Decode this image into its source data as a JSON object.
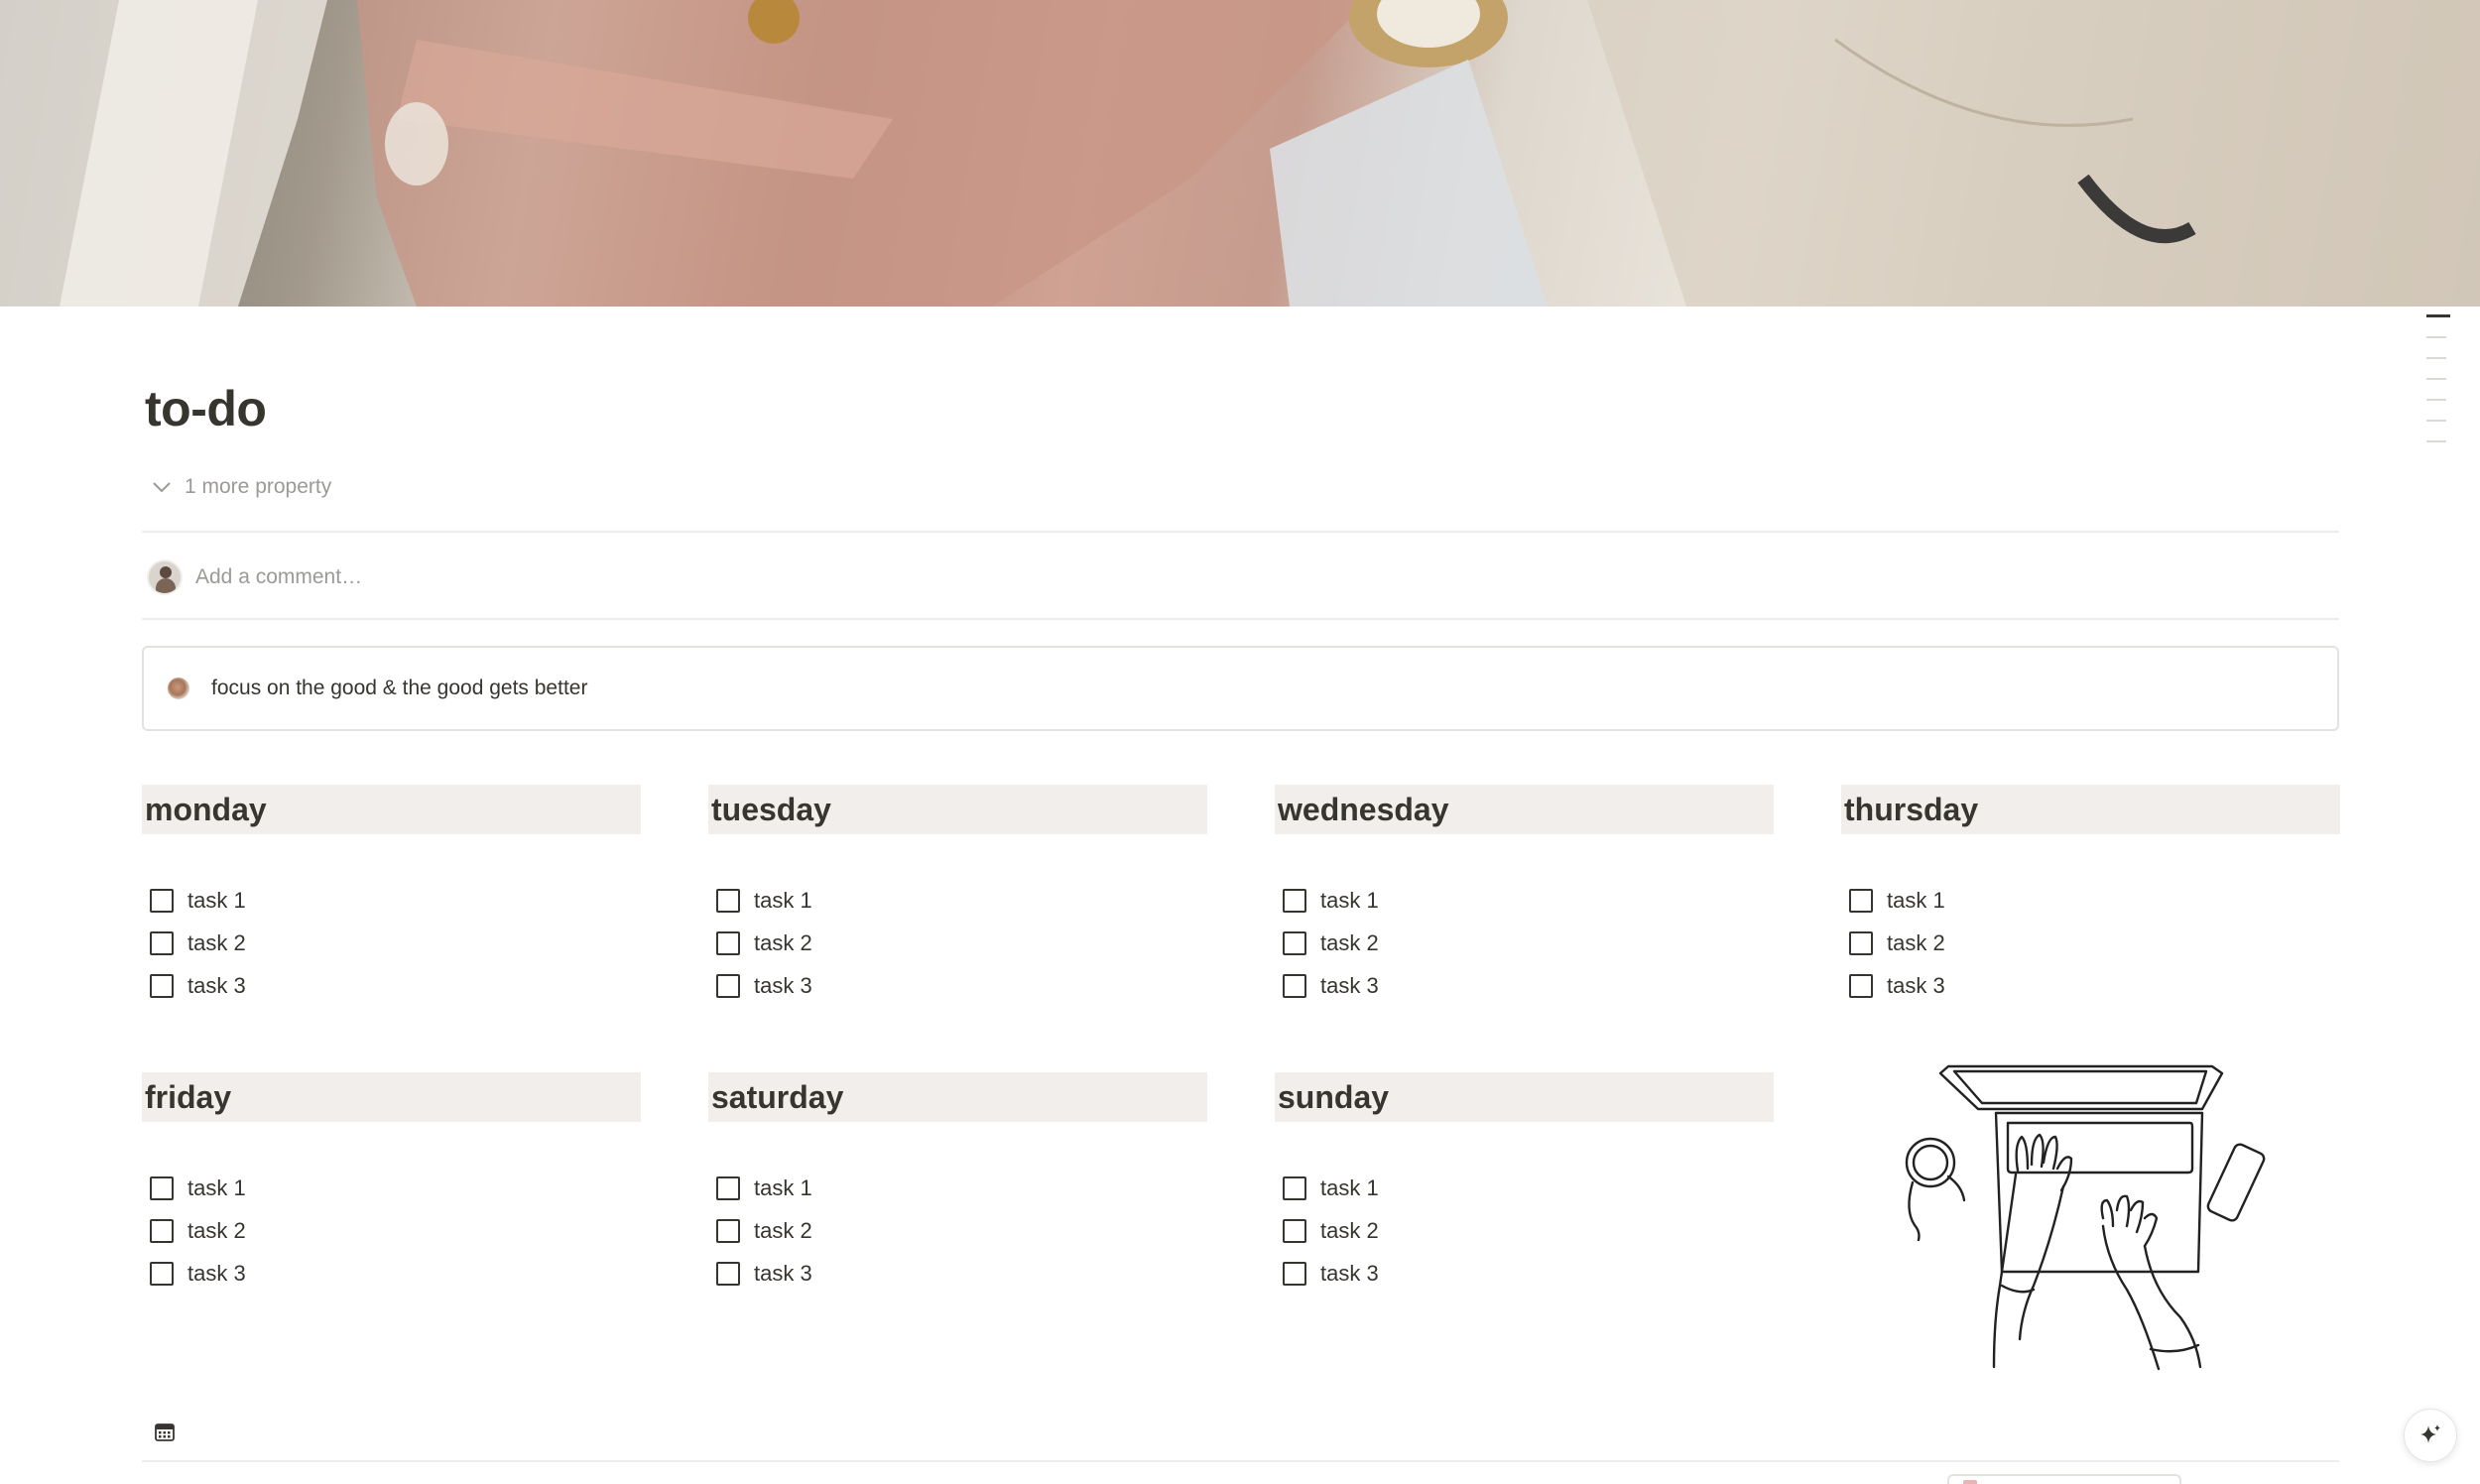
{
  "page": {
    "title": "to-do",
    "more_property": "1 more property",
    "comment_placeholder": "Add a comment…"
  },
  "callout": {
    "text": "focus on the good & the good gets better"
  },
  "days": [
    {
      "name": "monday",
      "tasks": [
        "task 1",
        "task 2",
        "task 3"
      ]
    },
    {
      "name": "tuesday",
      "tasks": [
        "task 1",
        "task 2",
        "task 3"
      ]
    },
    {
      "name": "wednesday",
      "tasks": [
        "task 1",
        "task 2",
        "task 3"
      ]
    },
    {
      "name": "thursday",
      "tasks": [
        "task 1",
        "task 2",
        "task 3"
      ]
    },
    {
      "name": "friday",
      "tasks": [
        "task 1",
        "task 2",
        "task 3"
      ]
    },
    {
      "name": "saturday",
      "tasks": [
        "task 1",
        "task 2",
        "task 3"
      ]
    },
    {
      "name": "sunday",
      "tasks": [
        "task 1",
        "task 2",
        "task 3"
      ]
    }
  ],
  "icons": {
    "more_property": "chevron-down-icon",
    "calendar": "calendar-icon",
    "ai": "sparkle-icon",
    "avatar": "user-avatar",
    "callout": "blurred-dot-icon",
    "illustration": "laptop-typing-illustration"
  },
  "colors": {
    "text": "#37352f",
    "muted": "#9b9a97",
    "day_header_bg": "#f1eeec",
    "divider": "#ededec",
    "callout_border": "#e3e2df"
  }
}
